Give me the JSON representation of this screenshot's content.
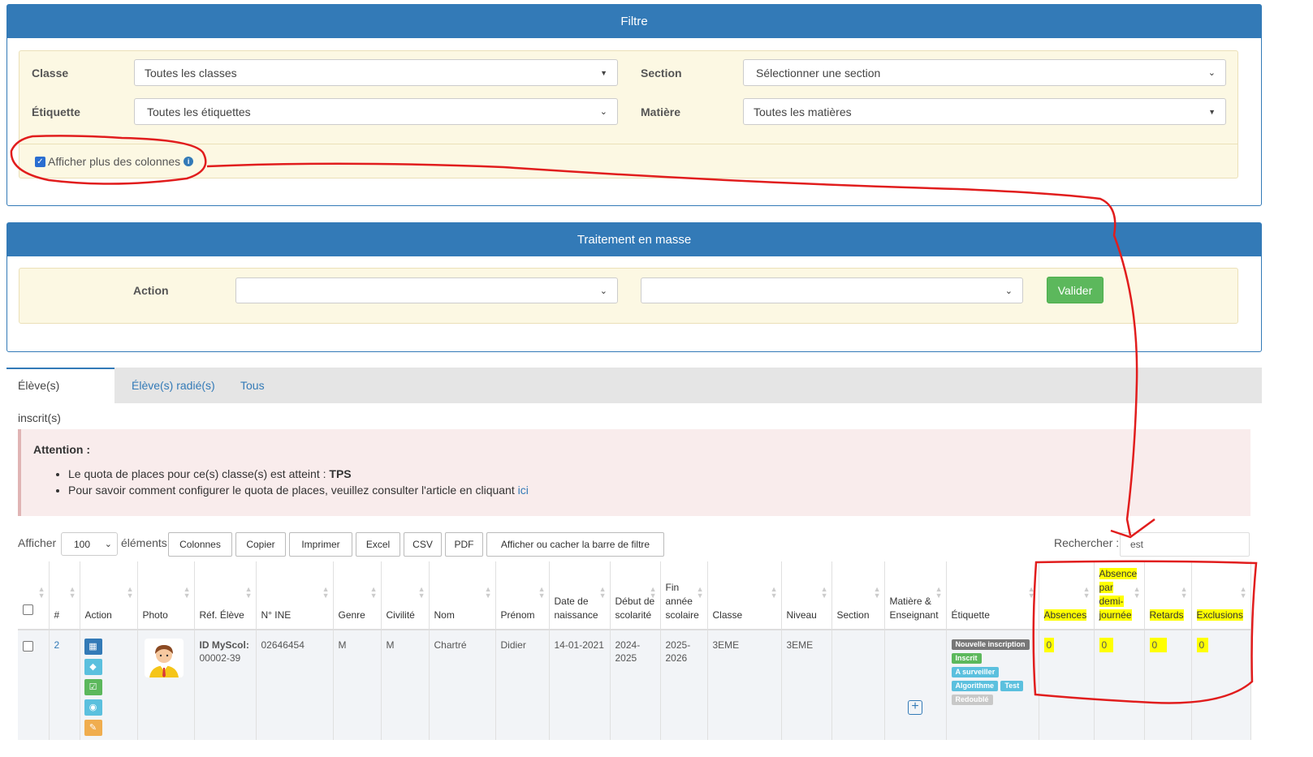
{
  "filtre": {
    "title": "Filtre",
    "classe_label": "Classe",
    "classe_value": "Toutes les classes",
    "section_label": "Section",
    "section_value": "Sélectionner une section",
    "etiquette_label": "Étiquette",
    "etiquette_value": "Toutes les étiquettes",
    "matiere_label": "Matière",
    "matiere_value": "Toutes les matières",
    "checkbox_label": "Afficher plus des colonnes"
  },
  "masse": {
    "title": "Traitement en masse",
    "action_label": "Action",
    "validate_label": "Valider"
  },
  "tabs": [
    "Élève(s) inscrit(s)",
    "Élève(s) radié(s)",
    "Tous"
  ],
  "alert": {
    "title": "Attention :",
    "line1_prefix": "Le quota de places pour ce(s) classe(s) est atteint : ",
    "line1_bold": "TPS",
    "line2_prefix": "Pour savoir comment configurer le quota de places, veuillez consulter l'article en cliquant ",
    "line2_link": "ici"
  },
  "toolbar": {
    "show_label": "Afficher",
    "show_value": "100",
    "elements_label": "éléments",
    "buttons": [
      "Colonnes",
      "Copier",
      "Imprimer",
      "Excel",
      "CSV",
      "PDF",
      "Afficher ou cacher la barre de filtre"
    ],
    "search_label": "Rechercher :",
    "search_value": "est"
  },
  "table": {
    "headers": {
      "num": "#",
      "action": "Action",
      "photo": "Photo",
      "ref": "Réf. Élève",
      "ine": "N° INE",
      "genre": "Genre",
      "civilite": "Civilité",
      "nom": "Nom",
      "prenom": "Prénom",
      "naissance": "Date de naissance",
      "debut": "Début de scolarité",
      "fin": "Fin année scolaire",
      "classe": "Classe",
      "niveau": "Niveau",
      "section": "Section",
      "matiere": "Matière & Enseignant",
      "etiquette": "Étiquette",
      "absences": "Absences",
      "absdemi": "Absence par demi-journée",
      "retards": "Retards",
      "exclusions": "Exclusions"
    },
    "row": {
      "num": "2",
      "ref_bold": "ID MyScol:",
      "ref_value": "00002-39",
      "ine": "02646454",
      "genre": "M",
      "civilite": "M",
      "nom": "Chartré",
      "prenom": "Didier",
      "naissance": "14-01-2021",
      "debut": "2024-2025",
      "fin": "2025-2026",
      "classe": "3EME",
      "niveau": "3EME",
      "section": "",
      "absences": "0",
      "absdemi": "0",
      "retards": "0",
      "exclusions": "0",
      "tags": [
        "Nouvelle inscription",
        "Inscrit",
        "A surveiller",
        "Algorithme",
        "Test",
        "Redoublé"
      ]
    }
  },
  "colors": {
    "primary": "#337ab7",
    "success": "#5cb85c",
    "info": "#5bc0de",
    "annotation": "#e11d1d",
    "highlight": "#ffff00"
  }
}
